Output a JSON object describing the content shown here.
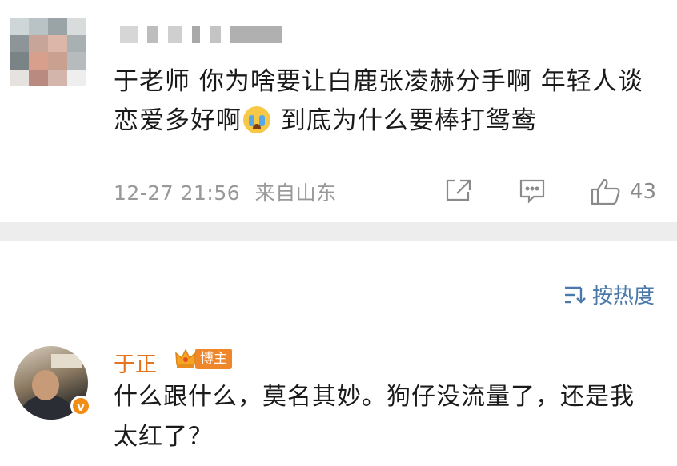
{
  "post": {
    "avatar": "blurred-avatar",
    "username": "",
    "text_part1": "于老师 你为啥要让白鹿张凌赫分手啊 年轻人谈恋爱多好啊",
    "emoji": "crying-face-emoji",
    "text_part2": " 到底为什么要棒打鸳鸯",
    "timestamp": "12-27 21:56",
    "location": "来自山东",
    "like_count": "43",
    "icons": {
      "share": "share-icon",
      "comment": "comment-icon",
      "like": "thumbs-up-icon"
    }
  },
  "sort": {
    "label": "按热度",
    "icon": "sort-icon"
  },
  "reply": {
    "name": "于正",
    "badge_label": "博主",
    "verified_mark": "v",
    "text": "什么跟什么，莫名其妙。狗仔没流量了，还是我太红了？"
  },
  "colors": {
    "name_orange": "#e5741d",
    "link_blue": "#4a78a8",
    "meta_gray": "#999999",
    "divider_gray": "#ededed",
    "badge_orange": "#f0862a"
  }
}
